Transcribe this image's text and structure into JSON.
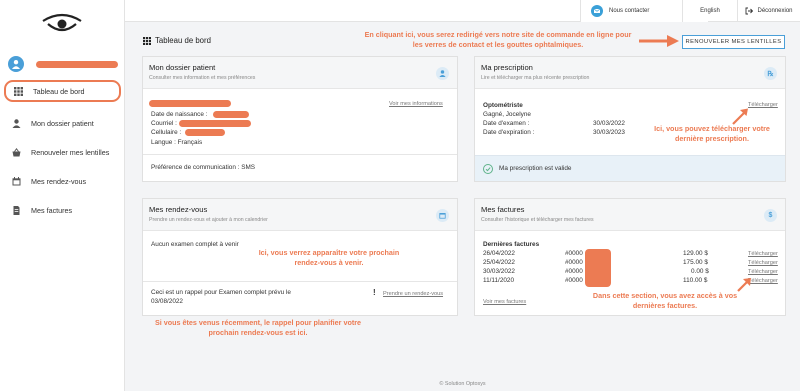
{
  "sidebar": {
    "items": [
      {
        "label": "Tableau de bord",
        "icon": "grid-icon"
      },
      {
        "label": "Mon dossier patient",
        "icon": "user-icon"
      },
      {
        "label": "Renouveler mes lentilles",
        "icon": "basket-icon"
      },
      {
        "label": "Mes rendez-vous",
        "icon": "calendar-icon"
      },
      {
        "label": "Mes factures",
        "icon": "document-icon"
      }
    ]
  },
  "topbar": {
    "contact": "Nous contacter",
    "language": "English",
    "logout": "Déconnexion"
  },
  "page": {
    "title": "Tableau de bord",
    "renew_button": "RENOUVELER MES LENTILLES"
  },
  "dossier": {
    "title": "Mon dossier patient",
    "subtitle": "Consulter mes information et mes préférences",
    "link": "Voir mes informations",
    "birth_label": "Date de naissance :",
    "email_label": "Courriel :",
    "phone_label": "Cellulaire :",
    "language_line": "Langue : Français",
    "comm_pref": "Préférence de communication : SMS"
  },
  "prescription": {
    "title": "Ma prescription",
    "subtitle": "Lire et télécharger ma plus récente prescription",
    "role": "Optométriste",
    "doctor": "Gagné, Jocelyne",
    "exam_label": "Date d'examen :",
    "exam_date": "30/03/2022",
    "expiry_label": "Date d'expiration :",
    "expiry_date": "30/03/2023",
    "download": "Télécharger",
    "valid": "Ma prescription est valide"
  },
  "appointments": {
    "title": "Mes rendez-vous",
    "subtitle": "Prendre un rendez-vous et ajouter à mon calendrier",
    "none": "Aucun examen complet à venir",
    "reminder_line1": "Ceci est un rappel pour Examen complet prévu le",
    "reminder_line2": "03/08/2022",
    "book_link": "Prendre un rendez-vous"
  },
  "invoices": {
    "title": "Mes factures",
    "subtitle": "Consulter l'historique et télécharger mes factures",
    "heading": "Dernières factures",
    "rows": [
      {
        "date": "26/04/2022",
        "number": "#0000",
        "amount": "129.00 $",
        "link": "Télécharger"
      },
      {
        "date": "25/04/2022",
        "number": "#0000",
        "amount": "175.00 $",
        "link": "Télécharger"
      },
      {
        "date": "30/03/2022",
        "number": "#0000",
        "amount": "0.00 $",
        "link": "Télécharger"
      },
      {
        "date": "11/11/2020",
        "number": "#0000",
        "amount": "110.00 $",
        "link": "Télécharger"
      }
    ],
    "view_all": "Voir mes factures"
  },
  "annotations": {
    "top": "En cliquant ici, vous serez redirigé vers notre site de commande en ligne pour les verres de contact et les gouttes ophtalmiques.",
    "prescription": "Ici, vous pouvez télécharger votre dernière prescription.",
    "appointment": "Ici, vous verrez apparaître votre prochain rendez-vous à venir.",
    "reminder": "Si vous êtes venus récemment, le rappel pour planifier votre prochain rendez-vous est ici.",
    "invoices": "Dans cette section, vous avez accès à vos dernières factures."
  },
  "footer": "© Solution Optosys",
  "colors": {
    "accent": "#ec7b53",
    "blue": "#4a9fd8"
  }
}
